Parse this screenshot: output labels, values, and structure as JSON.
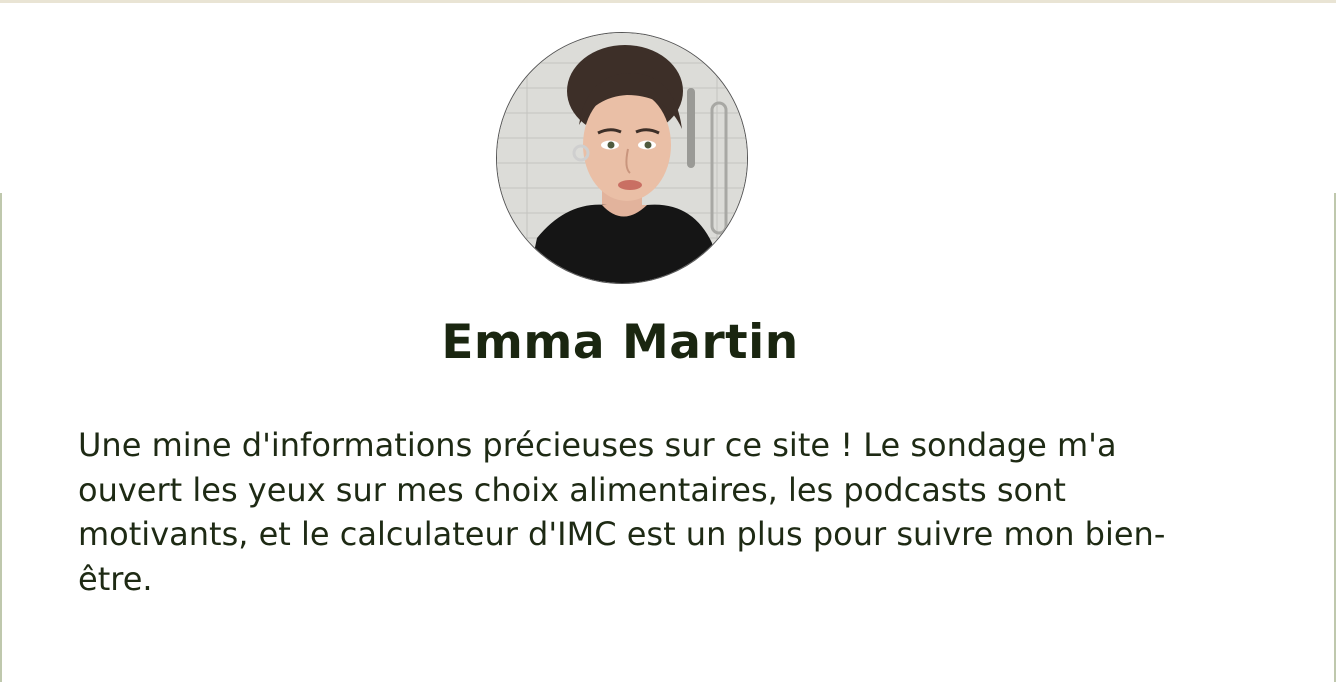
{
  "testimonial": {
    "name": "Emma Martin",
    "quote": "Une mine d'informations précieuses sur ce site ! Le sondage m'a ouvert les yeux sur mes choix alimentaires, les podcasts sont motivants, et le calculateur d'IMC est un plus pour suivre mon bien-être.",
    "avatar_icon": "user-photo-avatar"
  },
  "colors": {
    "name_text": "#1a2610",
    "body_text": "#1e2a14",
    "top_border": "#e9e4d4",
    "side_accent": "#8a9a6a"
  }
}
